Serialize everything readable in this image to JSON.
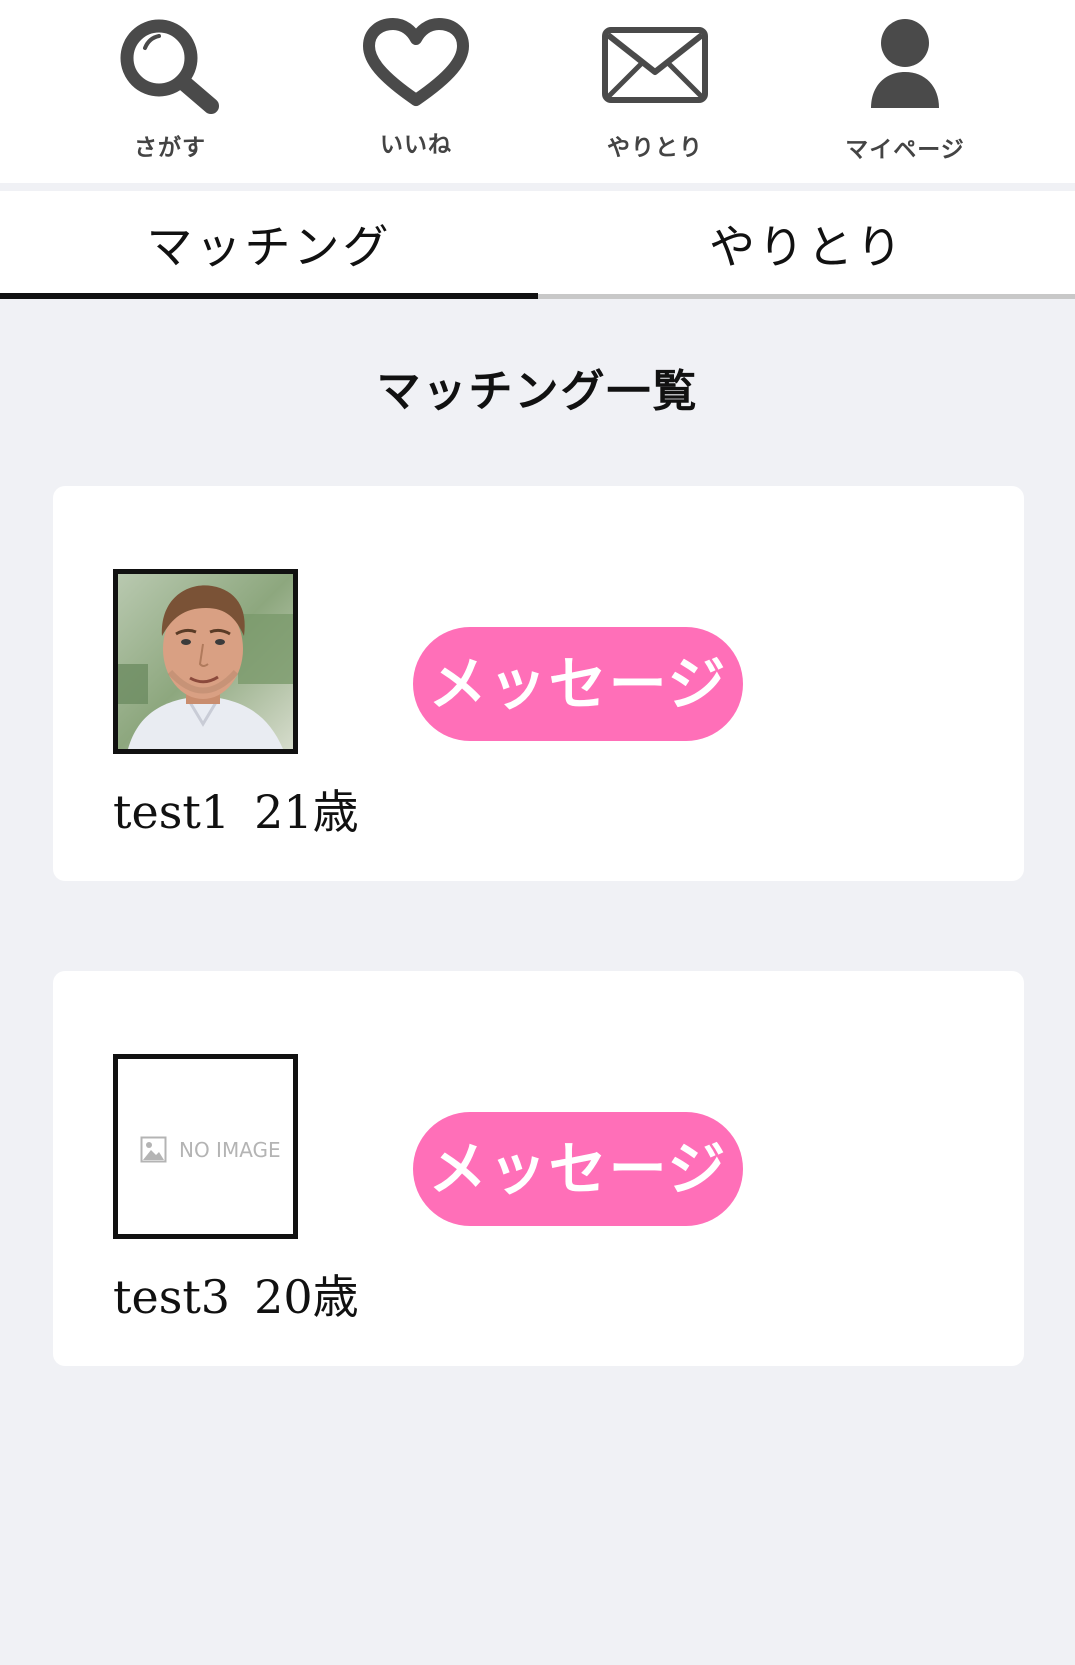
{
  "nav": {
    "items": [
      {
        "label": "さがす",
        "icon": "search-icon"
      },
      {
        "label": "いいね",
        "icon": "heart-icon"
      },
      {
        "label": "やりとり",
        "icon": "mail-icon"
      },
      {
        "label": "マイページ",
        "icon": "user-icon"
      }
    ],
    "icon_color": "#4a4a4a"
  },
  "tabs": [
    {
      "label": "マッチング",
      "active": true
    },
    {
      "label": "やりとり",
      "active": false
    }
  ],
  "page_title": "マッチング一覧",
  "matches": [
    {
      "name": "test1",
      "age": "21歳",
      "has_photo": true,
      "message_label": "メッセージ"
    },
    {
      "name": "test3",
      "age": "20歳",
      "has_photo": false,
      "placeholder_text": "NO IMAGE",
      "message_label": "メッセージ"
    }
  ],
  "colors": {
    "accent_pink": "#ff6fb8",
    "background": "#f0f1f5",
    "text": "#111111"
  }
}
